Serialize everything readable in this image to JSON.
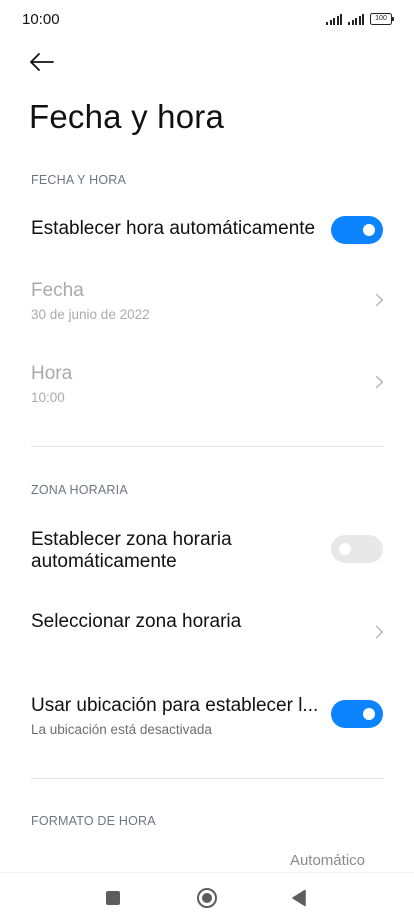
{
  "status_bar": {
    "time": "10:00",
    "battery": "100"
  },
  "header": {
    "title": "Fecha y hora"
  },
  "sections": {
    "date_time": {
      "header": "FECHA Y HORA",
      "auto_time": {
        "label": "Establecer hora automáticamente",
        "enabled": true
      },
      "date": {
        "label": "Fecha",
        "value": "30 de junio de 2022"
      },
      "time": {
        "label": "Hora",
        "value": "10:00"
      }
    },
    "time_zone": {
      "header": "ZONA HORARIA",
      "auto_zone": {
        "label_line1": "Establecer zona horaria",
        "label_line2": "automáticamente",
        "enabled": false
      },
      "select_zone": {
        "label": "Seleccionar zona horaria"
      },
      "use_location": {
        "label": "Usar ubicación para establecer l...",
        "sub": "La ubicación está desactivada",
        "enabled": true
      }
    },
    "time_format": {
      "header": "FORMATO DE HORA",
      "value": "Automático"
    }
  },
  "colors": {
    "accent": "#0d84ff",
    "toggle_off": "#e8e8e8",
    "disabled_text": "#a9a9a9"
  },
  "nav_icons": [
    "recents-icon",
    "home-icon",
    "back-icon"
  ]
}
